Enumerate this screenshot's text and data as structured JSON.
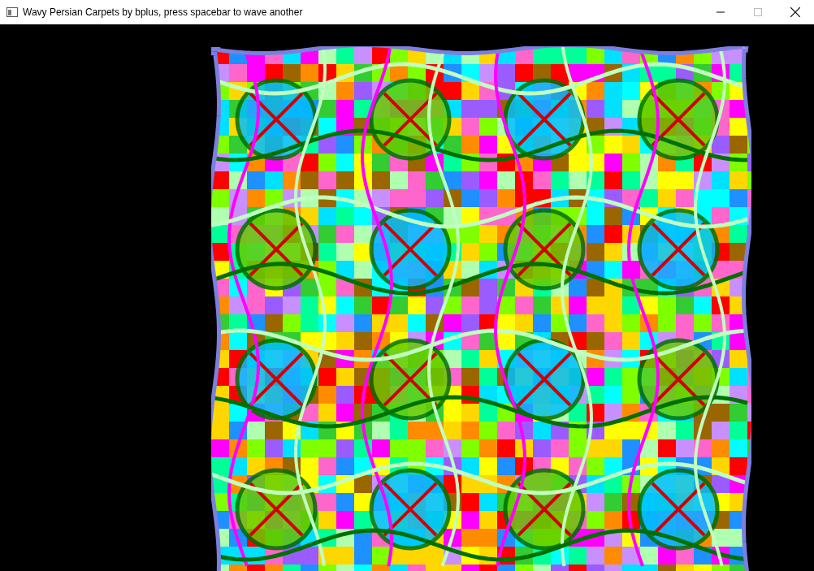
{
  "window": {
    "title": "Wavy Persian Carpets by bplus, press spacebar to wave another"
  }
}
